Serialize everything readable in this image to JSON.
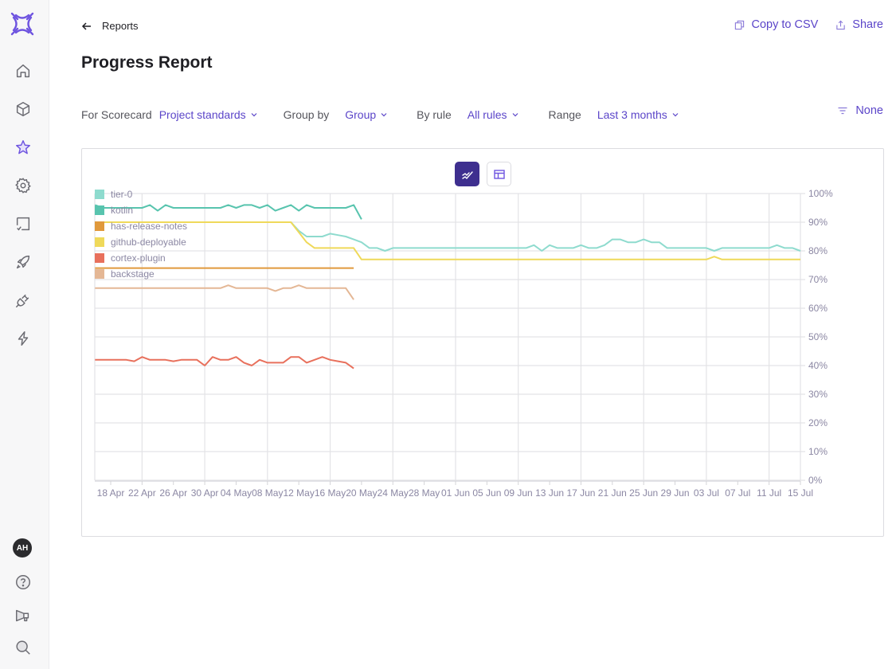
{
  "app": {
    "nav": [
      {
        "name": "home",
        "icon": "home-icon"
      },
      {
        "name": "catalog",
        "icon": "cube-icon"
      },
      {
        "name": "scorecards",
        "icon": "star-icon",
        "active": true
      },
      {
        "name": "settings",
        "icon": "gear-icon"
      },
      {
        "name": "tasks",
        "icon": "checklist-icon"
      },
      {
        "name": "deploys",
        "icon": "rocket-icon"
      },
      {
        "name": "integrations",
        "icon": "plug-icon"
      },
      {
        "name": "actions",
        "icon": "lightning-icon"
      }
    ],
    "bottom_nav": [
      {
        "name": "help",
        "icon": "help-icon"
      },
      {
        "name": "announcements",
        "icon": "megaphone-icon"
      },
      {
        "name": "search",
        "icon": "search-icon"
      }
    ],
    "avatar_initials": "AH",
    "accent_color": "#5b45c9"
  },
  "header": {
    "back_label": "Reports",
    "title": "Progress Report",
    "copy_csv_label": "Copy to CSV",
    "share_label": "Share"
  },
  "filters": {
    "scorecard_label": "For Scorecard",
    "scorecard_value": "Project standards",
    "group_by_label": "Group by",
    "group_by_value": "Group",
    "rule_label": "By rule",
    "rule_value": "All rules",
    "range_label": "Range",
    "range_value": "Last 3 months",
    "sort_value": "None"
  },
  "view_toggle": {
    "active": "chart",
    "options": [
      "chart",
      "table"
    ]
  },
  "chart_data": {
    "type": "line",
    "title": "",
    "xlabel": "",
    "ylabel": "",
    "ylim": [
      0,
      100
    ],
    "y_ticks": [
      "0%",
      "10%",
      "20%",
      "30%",
      "40%",
      "50%",
      "60%",
      "70%",
      "80%",
      "90%",
      "100%"
    ],
    "x_tick_labels": [
      "18 Apr",
      "22 Apr",
      "26 Apr",
      "30 Apr",
      "04 May",
      "08 May",
      "12 May",
      "16 May",
      "20 May",
      "24 May",
      "28 May",
      "01 Jun",
      "05 Jun",
      "09 Jun",
      "13 Jun",
      "17 Jun",
      "21 Jun",
      "25 Jun",
      "29 Jun",
      "03 Jul",
      "07 Jul",
      "11 Jul",
      "15 Jul"
    ],
    "x_start_day": -2,
    "x_end_day": 88,
    "x_day_origin": "18 Apr",
    "grid": true,
    "legend_position": "top-left",
    "series": [
      {
        "name": "tier-0",
        "color": "#8edbce",
        "points": [
          [
            -2,
            90
          ],
          [
            0,
            90
          ],
          [
            4,
            90
          ],
          [
            8,
            90
          ],
          [
            12,
            90
          ],
          [
            16,
            90
          ],
          [
            20,
            90
          ],
          [
            23,
            90
          ],
          [
            24,
            87
          ],
          [
            25,
            85
          ],
          [
            26,
            85
          ],
          [
            27,
            85
          ],
          [
            28,
            86
          ],
          [
            29,
            85.5
          ],
          [
            30,
            85
          ],
          [
            31,
            84
          ],
          [
            32,
            83
          ],
          [
            33,
            81
          ],
          [
            34,
            81
          ],
          [
            35,
            80
          ],
          [
            36,
            81
          ],
          [
            40,
            81
          ],
          [
            44,
            81
          ],
          [
            48,
            81
          ],
          [
            52,
            81
          ],
          [
            53,
            81
          ],
          [
            54,
            82
          ],
          [
            55,
            80
          ],
          [
            56,
            82
          ],
          [
            57,
            81
          ],
          [
            58,
            81
          ],
          [
            59,
            81
          ],
          [
            60,
            82
          ],
          [
            61,
            81
          ],
          [
            62,
            81
          ],
          [
            63,
            82
          ],
          [
            64,
            84
          ],
          [
            65,
            84
          ],
          [
            66,
            83
          ],
          [
            67,
            83
          ],
          [
            68,
            84
          ],
          [
            69,
            83
          ],
          [
            70,
            83
          ],
          [
            71,
            81
          ],
          [
            74,
            81
          ],
          [
            75,
            81
          ],
          [
            76,
            81
          ],
          [
            77,
            80
          ],
          [
            78,
            81
          ],
          [
            84,
            81
          ],
          [
            85,
            82
          ],
          [
            86,
            81
          ],
          [
            87,
            81
          ],
          [
            88,
            80
          ]
        ]
      },
      {
        "name": "kotlin",
        "color": "#58c4ae",
        "points": [
          [
            -2,
            96
          ],
          [
            -1,
            95
          ],
          [
            0,
            95
          ],
          [
            2,
            95
          ],
          [
            3,
            95
          ],
          [
            4,
            95
          ],
          [
            5,
            96
          ],
          [
            6,
            94
          ],
          [
            7,
            96
          ],
          [
            8,
            95
          ],
          [
            9,
            95
          ],
          [
            11,
            95
          ],
          [
            14,
            95
          ],
          [
            15,
            96
          ],
          [
            16,
            95
          ],
          [
            17,
            96
          ],
          [
            18,
            96
          ],
          [
            19,
            95
          ],
          [
            20,
            96
          ],
          [
            21,
            94
          ],
          [
            22,
            95
          ],
          [
            23,
            96
          ],
          [
            24,
            94
          ],
          [
            25,
            96
          ],
          [
            26,
            95
          ],
          [
            28,
            95
          ],
          [
            30,
            95
          ],
          [
            31,
            96
          ],
          [
            32,
            91
          ]
        ]
      },
      {
        "name": "has-release-notes",
        "color": "#e0993c",
        "points": [
          [
            -2,
            74
          ],
          [
            0,
            74
          ],
          [
            8,
            74
          ],
          [
            16,
            74
          ],
          [
            24,
            74
          ],
          [
            31,
            74
          ]
        ]
      },
      {
        "name": "github-deployable",
        "color": "#efd95a",
        "points": [
          [
            -2,
            90
          ],
          [
            23,
            90
          ],
          [
            25,
            83
          ],
          [
            26,
            81
          ],
          [
            28,
            81
          ],
          [
            30,
            81
          ],
          [
            31,
            81
          ],
          [
            32,
            77
          ],
          [
            36,
            77
          ],
          [
            44,
            77
          ],
          [
            52,
            77
          ],
          [
            60,
            77
          ],
          [
            68,
            77
          ],
          [
            76,
            77
          ],
          [
            77,
            78
          ],
          [
            78,
            77
          ],
          [
            82,
            77
          ],
          [
            88,
            77
          ]
        ]
      },
      {
        "name": "cortex-plugin",
        "color": "#e8705c",
        "points": [
          [
            -2,
            42
          ],
          [
            0,
            42
          ],
          [
            2,
            42
          ],
          [
            3,
            41.5
          ],
          [
            4,
            43
          ],
          [
            5,
            42
          ],
          [
            7,
            42
          ],
          [
            8,
            41.5
          ],
          [
            9,
            42
          ],
          [
            11,
            42
          ],
          [
            12,
            40
          ],
          [
            13,
            43
          ],
          [
            14,
            42
          ],
          [
            15,
            42
          ],
          [
            16,
            43
          ],
          [
            17,
            41
          ],
          [
            18,
            40
          ],
          [
            19,
            42
          ],
          [
            20,
            41
          ],
          [
            22,
            41
          ],
          [
            23,
            43
          ],
          [
            24,
            43
          ],
          [
            25,
            41
          ],
          [
            26,
            42
          ],
          [
            27,
            43
          ],
          [
            28,
            42
          ],
          [
            29,
            41.5
          ],
          [
            30,
            41
          ],
          [
            31,
            39
          ]
        ]
      },
      {
        "name": "backstage",
        "color": "#e4b795",
        "points": [
          [
            -2,
            67
          ],
          [
            0,
            67
          ],
          [
            4,
            67
          ],
          [
            8,
            67
          ],
          [
            14,
            67
          ],
          [
            15,
            68
          ],
          [
            16,
            67
          ],
          [
            18,
            67
          ],
          [
            20,
            67
          ],
          [
            21,
            66
          ],
          [
            22,
            67
          ],
          [
            23,
            67
          ],
          [
            24,
            68
          ],
          [
            25,
            67
          ],
          [
            27,
            67
          ],
          [
            29,
            67
          ],
          [
            30,
            67
          ],
          [
            31,
            63
          ]
        ]
      }
    ]
  }
}
